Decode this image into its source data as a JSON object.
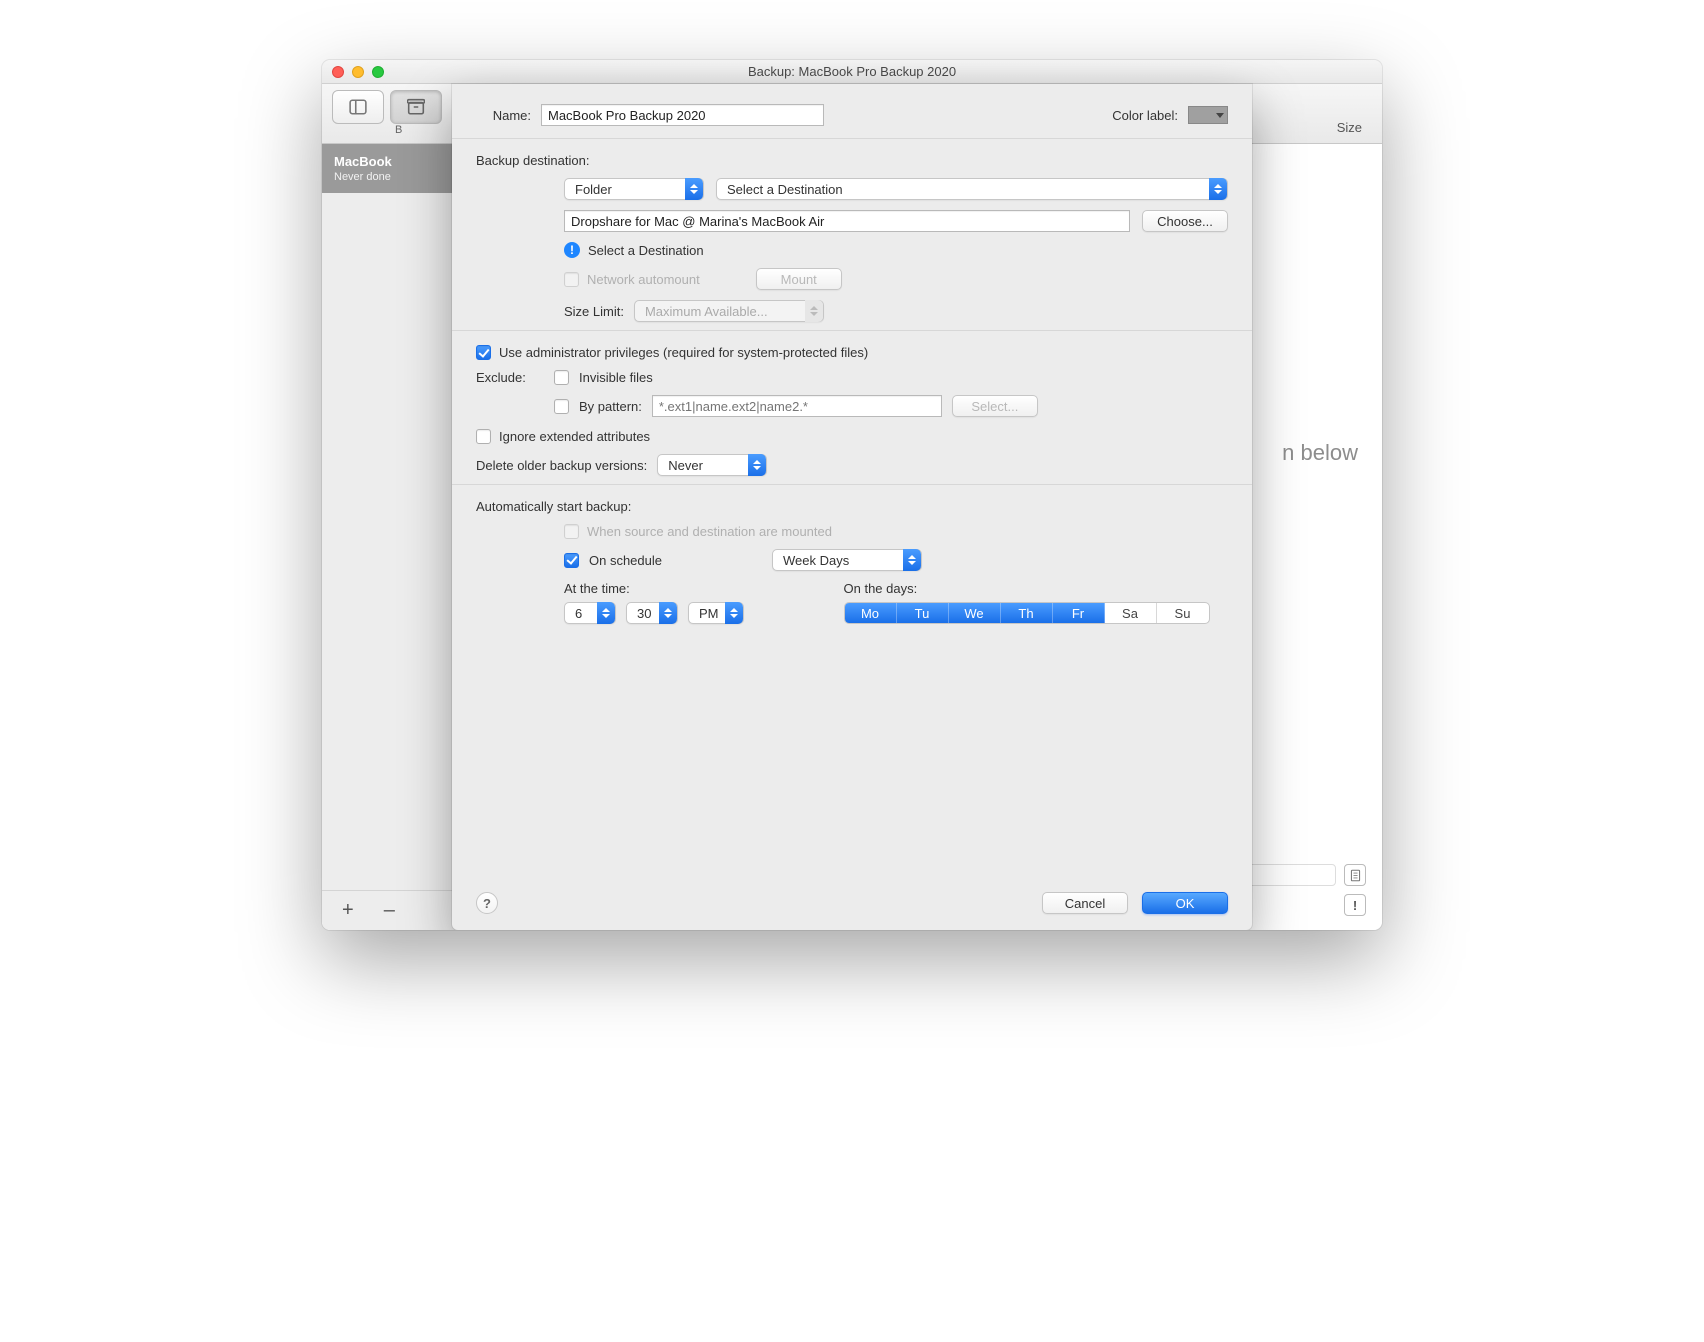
{
  "window": {
    "title": "Backup: MacBook Pro Backup 2020"
  },
  "toolbar": {
    "label_segment": "B",
    "col_size": "Size"
  },
  "sidebar": {
    "item": {
      "title": "MacBook",
      "subtitle": "Never done"
    },
    "add": "+",
    "remove": "–"
  },
  "behind": {
    "text": "n below"
  },
  "sheet": {
    "name_label": "Name:",
    "name_value": "MacBook Pro Backup 2020",
    "color_label": "Color label:",
    "dest_title": "Backup destination:",
    "dest_type": "Folder",
    "dest_select": "Select a Destination",
    "dest_path": "Dropshare for Mac @ Marina's MacBook Air",
    "choose": "Choose...",
    "info_text": "Select a Destination",
    "net_automount": "Network automount",
    "mount": "Mount",
    "size_label": "Size Limit:",
    "size_val": "Maximum Available...",
    "admin": "Use administrator privileges (required for system-protected files)",
    "exclude_label": "Exclude:",
    "invisible": "Invisible files",
    "by_pattern": "By pattern:",
    "pattern_ph": "*.ext1|name.ext2|name2.*",
    "select_btn": "Select...",
    "ignore_xattr": "Ignore extended attributes",
    "delete_older": "Delete older backup versions:",
    "delete_older_val": "Never",
    "auto_title": "Automatically start backup:",
    "when_mounted": "When source and destination are mounted",
    "on_schedule": "On schedule",
    "schedule_type": "Week Days",
    "at_time": "At the time:",
    "hour": "6",
    "minute": "30",
    "ampm": "PM",
    "on_days": "On the days:",
    "days": {
      "mo": "Mo",
      "tu": "Tu",
      "we": "We",
      "th": "Th",
      "fr": "Fr",
      "sa": "Sa",
      "su": "Su"
    },
    "cancel": "Cancel",
    "ok": "OK",
    "help": "?"
  }
}
